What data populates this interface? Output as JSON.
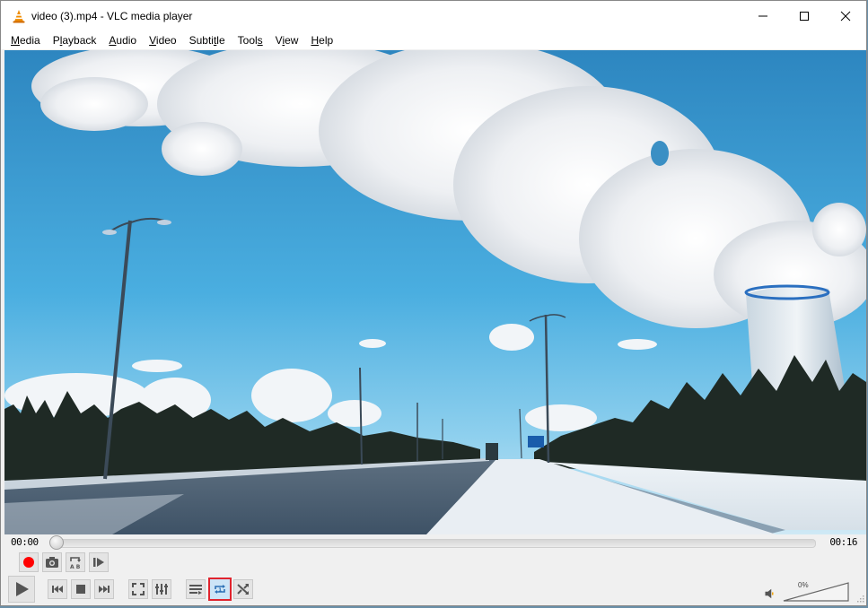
{
  "window": {
    "title": "video (3).mp4 - VLC media player",
    "controls": [
      "minimize",
      "maximize",
      "close"
    ]
  },
  "menu": [
    {
      "label": "Media",
      "mnemonic_index": 0
    },
    {
      "label": "Playback",
      "mnemonic_index": 1
    },
    {
      "label": "Audio",
      "mnemonic_index": 0
    },
    {
      "label": "Video",
      "mnemonic_index": 0
    },
    {
      "label": "Subtitle",
      "mnemonic_index": 5
    },
    {
      "label": "Tools",
      "mnemonic_index": 4
    },
    {
      "label": "View",
      "mnemonic_index": 1
    },
    {
      "label": "Help",
      "mnemonic_index": 0
    }
  ],
  "video": {
    "description": "Snowy highway with street lamps, pine trees, cooling tower and large white cloud under blue sky"
  },
  "playback": {
    "elapsed": "00:00",
    "duration": "00:16",
    "progress_fraction": 0.0
  },
  "controls_top": [
    {
      "name": "record",
      "icon": "record-icon"
    },
    {
      "name": "snapshot",
      "icon": "camera-icon"
    },
    {
      "name": "ab-loop",
      "icon": "ab-loop-icon"
    },
    {
      "name": "frame-by-frame",
      "icon": "frame-step-icon"
    }
  ],
  "controls_bottom": [
    {
      "name": "play",
      "icon": "play-icon"
    },
    {
      "name": "previous",
      "icon": "previous-icon"
    },
    {
      "name": "stop",
      "icon": "stop-icon"
    },
    {
      "name": "next",
      "icon": "next-icon"
    },
    {
      "name": "fullscreen",
      "icon": "fullscreen-icon"
    },
    {
      "name": "extended-settings",
      "icon": "equalizer-icon"
    },
    {
      "name": "playlist",
      "icon": "playlist-icon"
    },
    {
      "name": "loop",
      "icon": "loop-one-icon",
      "active": true,
      "highlighted": true
    },
    {
      "name": "random",
      "icon": "shuffle-icon"
    }
  ],
  "volume": {
    "label": "0%",
    "level_percent": 0,
    "muted_icon": "speaker-icon"
  },
  "colors": {
    "highlight_border": "#e0242e",
    "active_button_bg": "#cce4f7",
    "record_red": "#ff0000",
    "vlc_orange": "#f08c00"
  }
}
